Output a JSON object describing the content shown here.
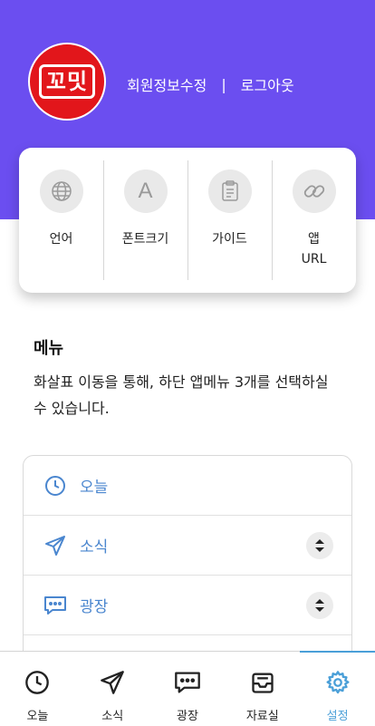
{
  "header": {
    "logo_text": "꼬밋",
    "edit_profile_label": "회원정보수정",
    "separator": "|",
    "logout_label": "로그아웃",
    "background_color": "#6b4ef0"
  },
  "quick_settings": [
    {
      "label": "언어",
      "icon": "globe-icon"
    },
    {
      "label": "폰트크기",
      "icon": "font-size-icon",
      "glyph": "A"
    },
    {
      "label": "가이드",
      "icon": "clipboard-icon"
    },
    {
      "label": "앱\nURL",
      "icon": "link-icon"
    }
  ],
  "menu": {
    "title": "메뉴",
    "description": "화살표 이동을 통해, 하단 앱메뉴 3개를 선택하실 수 있습니다.",
    "items": [
      {
        "label": "오늘",
        "icon": "clock-icon",
        "sortable": false
      },
      {
        "label": "소식",
        "icon": "send-icon",
        "sortable": true
      },
      {
        "label": "광장",
        "icon": "chat-icon",
        "sortable": true
      }
    ]
  },
  "tabbar": {
    "tabs": [
      {
        "label": "오늘",
        "icon": "clock-icon"
      },
      {
        "label": "소식",
        "icon": "send-icon"
      },
      {
        "label": "광장",
        "icon": "chat-icon"
      },
      {
        "label": "자료실",
        "icon": "archive-icon"
      },
      {
        "label": "설정",
        "icon": "gear-icon",
        "active": true
      }
    ],
    "active_color": "#4a9fd8"
  },
  "colors": {
    "menu_item_text": "#4a86cf",
    "logo_red": "#e2161b"
  }
}
